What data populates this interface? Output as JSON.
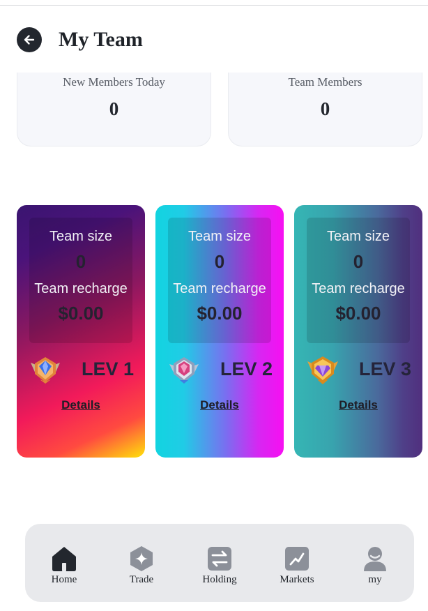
{
  "header": {
    "title": "My Team",
    "back_icon": "arrow-left-icon"
  },
  "stats": [
    {
      "label": "New Members Today",
      "value": "0"
    },
    {
      "label": "Team Members",
      "value": "0"
    }
  ],
  "levels": [
    {
      "size_label": "Team size",
      "size_value": "0",
      "recharge_label": "Team recharge",
      "recharge_value": "$0.00",
      "level": "LEV 1",
      "badge_icon": "blue-gem-badge-icon",
      "details_label": "Details"
    },
    {
      "size_label": "Team size",
      "size_value": "0",
      "recharge_label": "Team recharge",
      "recharge_value": "$0.00",
      "level": "LEV 2",
      "badge_icon": "pink-gem-badge-icon",
      "details_label": "Details"
    },
    {
      "size_label": "Team size",
      "size_value": "0",
      "recharge_label": "Team recharge",
      "recharge_value": "$0.00",
      "level": "LEV 3",
      "badge_icon": "purple-gem-badge-icon",
      "details_label": "Details"
    }
  ],
  "nav": [
    {
      "label": "Home",
      "icon": "home-icon",
      "active": true
    },
    {
      "label": "Trade",
      "icon": "trade-icon",
      "active": false
    },
    {
      "label": "Holding",
      "icon": "holding-icon",
      "active": false
    },
    {
      "label": "Markets",
      "icon": "markets-icon",
      "active": false
    },
    {
      "label": "my",
      "icon": "profile-icon",
      "active": false
    }
  ],
  "colors": {
    "active_icon": "#23272e",
    "inactive_icon": "#8c9099",
    "nav_bg": "#e8e9ec"
  }
}
